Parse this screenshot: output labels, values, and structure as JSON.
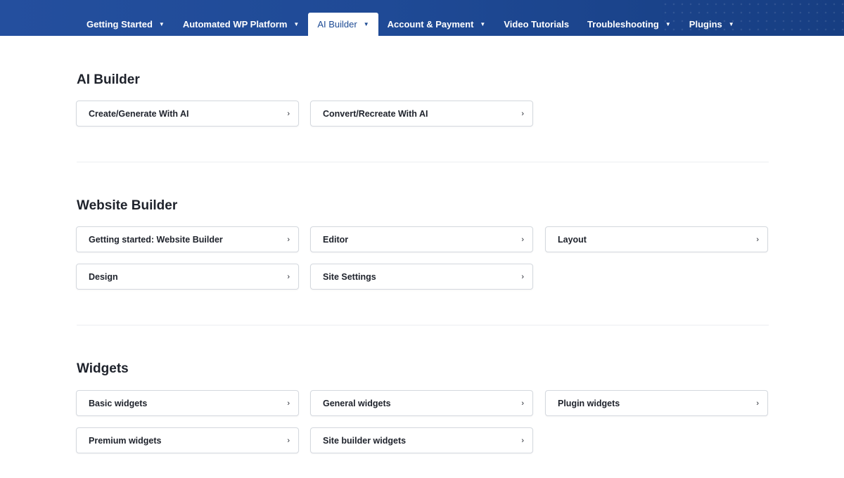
{
  "nav": {
    "items": [
      {
        "label": "Getting Started",
        "caret": "▼"
      },
      {
        "label": "Automated WP Platform",
        "caret": "▼"
      },
      {
        "label": "AI Builder",
        "caret": "▼"
      },
      {
        "label": "Account & Payment",
        "caret": "▼"
      },
      {
        "label": "Video Tutorials",
        "caret": ""
      },
      {
        "label": "Troubleshooting",
        "caret": "▼"
      },
      {
        "label": "Plugins",
        "caret": "▼"
      }
    ],
    "active": "AI Builder",
    "colors": {
      "bar": "#1f4a96",
      "active_text": "#1c4a94"
    }
  },
  "chevron": "›",
  "sections": [
    {
      "title": "AI Builder",
      "cards": [
        "Create/Generate With AI",
        "Convert/Recreate With AI"
      ]
    },
    {
      "title": "Website Builder",
      "cards": [
        "Getting started: Website Builder",
        "Editor",
        "Layout",
        "Design",
        "Site Settings"
      ]
    },
    {
      "title": "Widgets",
      "cards": [
        "Basic widgets",
        "General widgets",
        "Plugin widgets",
        "Premium widgets",
        "Site builder widgets"
      ]
    }
  ]
}
